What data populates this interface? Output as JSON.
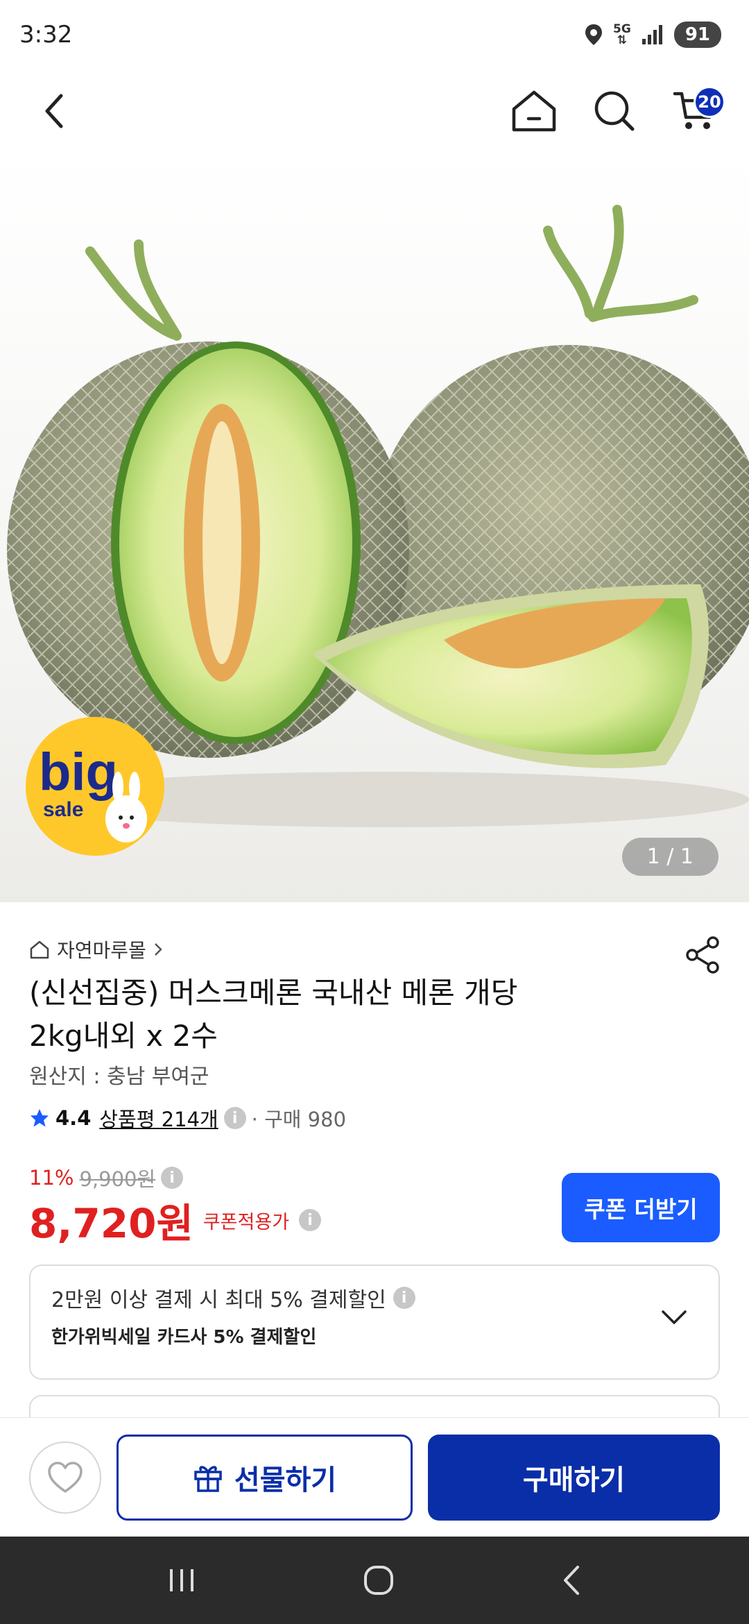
{
  "status_bar": {
    "time": "3:32",
    "network": "5G",
    "battery": "91"
  },
  "header": {
    "cart_count": "20"
  },
  "hero": {
    "counter": "1 / 1",
    "badge_top": "big",
    "badge_bottom": "sale"
  },
  "product": {
    "store": "자연마루몰",
    "title_line1": "(신선집중) 머스크메론 국내산 메론 개당",
    "title_line2": "2kg내외 x 2수",
    "origin": "원산지 : 충남 부여군",
    "rating": "4.4",
    "review_label": "상품평 214개",
    "purchases": "· 구매 980",
    "discount_rate": "11%",
    "original_price": "9,900원",
    "price": "8,720원",
    "coupon_note": "쿠폰적용가",
    "coupon_button": "쿠폰 더받기"
  },
  "promo": {
    "line1": "2만원 이상 결제 시 최대  5% 결제할인",
    "line2": "한가위빅세일  카드사 5% 결제할인"
  },
  "actions": {
    "gift": "선물하기",
    "buy": "구매하기"
  },
  "colors": {
    "accent_blue": "#0a2ea8",
    "coupon_blue": "#1a5cff",
    "price_red": "#e02020",
    "rating_star": "#1a5cff"
  }
}
